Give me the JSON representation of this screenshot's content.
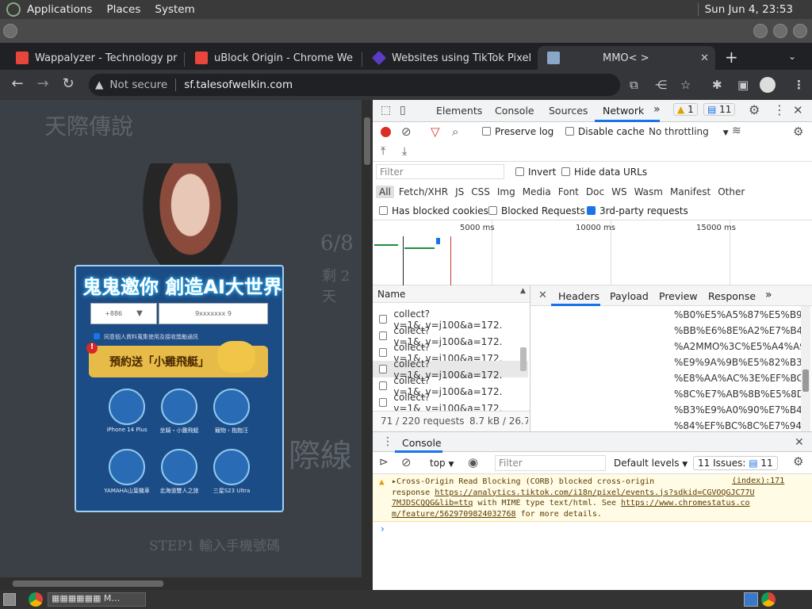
{
  "topbar": {
    "applications": "Applications",
    "places": "Places",
    "system": "System",
    "clock": "Sun Jun  4, 23:53"
  },
  "tabs": [
    {
      "title": "Wappalyzer - Technology pr",
      "color": "#e8453c"
    },
    {
      "title": "uBlock Origin - Chrome We",
      "color": "#e8453c"
    },
    {
      "title": "Websites using TikTok Pixel",
      "color": "#5b3cc4"
    },
    {
      "title": "MMO<        >",
      "color": "#8aa6c8"
    }
  ],
  "addressbar": {
    "security": "Not secure",
    "url": "sf.talesofwelkin.com"
  },
  "page": {
    "logo_text": "天際傳說",
    "headline": "鬼鬼邀你 創造AI大世界",
    "country_code": "+886",
    "phone_placeholder": "9xxxxxxx   9",
    "agree_text": "同意個人資料蒐集使用及接收獎勵通訊",
    "preorder_text": "預約送「小雞飛艇」",
    "prizes": [
      "iPhone 14 Plus",
      "坐騎・小雞飛艇",
      "寵物・抱抱汪",
      "YAMAHA山葉機車",
      "北海道雙人之旅",
      "三星S23 Ultra"
    ],
    "step1": "STEP1  輸入手機號碼",
    "side_text_1": "6/8",
    "side_text_2": "剩 2 天",
    "side_text_3": "際線"
  },
  "devtools": {
    "tabs": [
      "Elements",
      "Console",
      "Sources",
      "Network"
    ],
    "active_tab": "Network",
    "warn_count": "1",
    "msg_count": "11",
    "preserve_log": "Preserve log",
    "disable_cache": "Disable cache",
    "throttling": "No throttling",
    "filter_placeholder": "Filter",
    "invert": "Invert",
    "hide_data_urls": "Hide data URLs",
    "types": [
      "All",
      "Fetch/XHR",
      "JS",
      "CSS",
      "Img",
      "Media",
      "Font",
      "Doc",
      "WS",
      "Wasm",
      "Manifest",
      "Other"
    ],
    "has_blocked_cookies": "Has blocked cookies",
    "blocked_requests": "Blocked Requests",
    "third_party": "3rd-party requests",
    "timeline_ticks": [
      "5000 ms",
      "10000 ms",
      "15000 ms"
    ],
    "name_header": "Name",
    "requests": [
      "collect?v=1&_v=j100&a=172.",
      "collect?v=1&_v=j100&a=172.",
      "collect?v=1&_v=j100&a=172.",
      "collect?v=1&_v=j100&a=172.",
      "collect?v=1&_v=j100&a=172.",
      "collect?v=1&_v=j100&a=172."
    ],
    "detail_tabs": [
      "Headers",
      "Payload",
      "Preview",
      "Response"
    ],
    "header_lines": [
      "%B0%E5%A5%87%E5%B9",
      "%BB%E6%8E%A2%E7%B4",
      "%A2MMO%3C%E5%A4%A9",
      "%E9%9A%9B%E5%82%B3",
      "%E8%AA%AC%3E%EF%BC",
      "%8C%E7%AB%8B%E5%8D",
      "%B3%E9%A0%90%E7%B4",
      "%84%EF%BC%8C%E7%94"
    ],
    "status_requests": "71 / 220 requests",
    "status_size": "8.7 kB / 26.7 I",
    "console_title": "Console",
    "context": "top",
    "console_filter": "Filter",
    "levels": "Default levels",
    "issues": "11 Issues:",
    "issues_count": "11",
    "msg_line1": "Cross-Origin Read Blocking (CORB) blocked cross-origin",
    "msg_source": "(index):171",
    "msg_line2_pre": "response ",
    "msg_link1": "https://analytics.tiktok.com/i18n/pixel/events.js?sdkid=CGVOQGJC77U",
    "msg_link1b": "7MJDSCQQG&lib=ttq",
    "msg_line3_mid": " with MIME type text/html. See ",
    "msg_link2": "https://www.chromestatus.co",
    "msg_link2b": "m/feature/5629709824032768",
    "msg_tail": " for more details."
  }
}
